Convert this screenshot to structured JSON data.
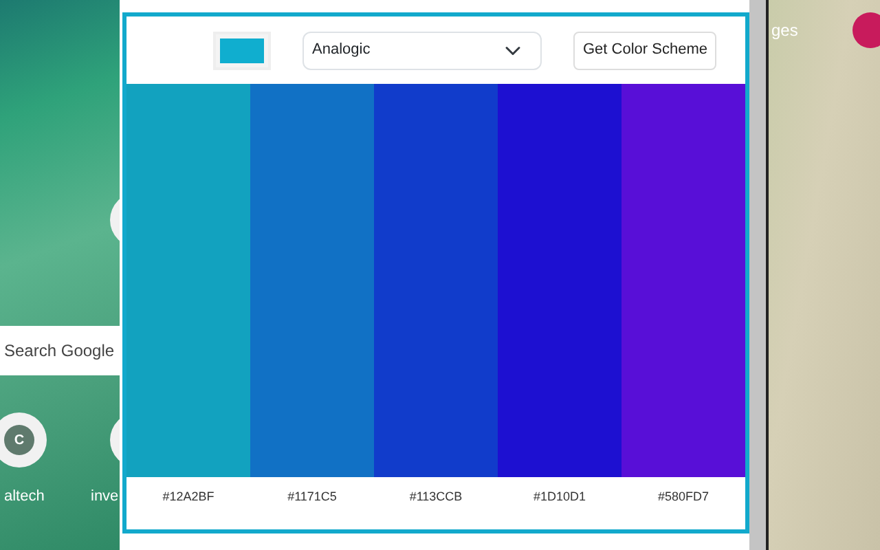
{
  "background_page": {
    "search_placeholder": "Search Google",
    "shortcuts": [
      {
        "label": "altech",
        "initial": "C"
      },
      {
        "label": "inve"
      }
    ],
    "header_link": "ges"
  },
  "popup": {
    "picker": {
      "color": "#10AECF"
    },
    "mode": "Analogic",
    "button": "Get Color Scheme",
    "swatches": [
      {
        "color": "#12A2BF",
        "hex": "#12A2BF"
      },
      {
        "color": "#1171C5",
        "hex": "#1171C5"
      },
      {
        "color": "#113CCB",
        "hex": "#113CCB"
      },
      {
        "color": "#1D10D1",
        "hex": "#1D10D1"
      },
      {
        "color": "#580FD7",
        "hex": "#580FD7"
      }
    ]
  }
}
